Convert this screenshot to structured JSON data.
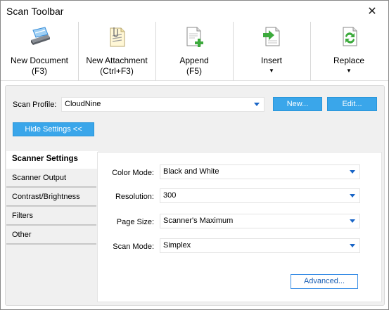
{
  "window": {
    "title": "Scan Toolbar",
    "close_glyph": "✕"
  },
  "toolbar": {
    "buttons": [
      {
        "label": "New Document",
        "shortcut": "(F3)",
        "icon": "scanner-icon"
      },
      {
        "label": "New Attachment",
        "shortcut": "(Ctrl+F3)",
        "icon": "paperclip-document-icon"
      },
      {
        "label": "Append",
        "shortcut": "(F5)",
        "icon": "document-add-icon"
      },
      {
        "label": "Insert",
        "dropdown_glyph": "▼",
        "icon": "document-insert-icon"
      },
      {
        "label": "Replace",
        "dropdown_glyph": "▼",
        "icon": "document-replace-icon"
      }
    ]
  },
  "profile": {
    "label": "Scan Profile:",
    "value": "CloudNine",
    "new_button": "New...",
    "edit_button": "Edit..."
  },
  "hide_settings_button": "Hide Settings <<",
  "tabs": [
    {
      "label": "Scanner Settings",
      "active": true
    },
    {
      "label": "Scanner Output",
      "active": false
    },
    {
      "label": "Contrast/Brightness",
      "active": false
    },
    {
      "label": "Filters",
      "active": false
    },
    {
      "label": "Other",
      "active": false
    }
  ],
  "fields": [
    {
      "label": "Color Mode:",
      "value": "Black and White"
    },
    {
      "label": "Resolution:",
      "value": "300"
    },
    {
      "label": "Page Size:",
      "value": "Scanner's Maximum"
    },
    {
      "label": "Scan Mode:",
      "value": "Simplex"
    }
  ],
  "advanced_button": "Advanced...",
  "colors": {
    "accent": "#3aa6ea",
    "caret": "#1a66c7",
    "panel": "#f0f0f0"
  }
}
